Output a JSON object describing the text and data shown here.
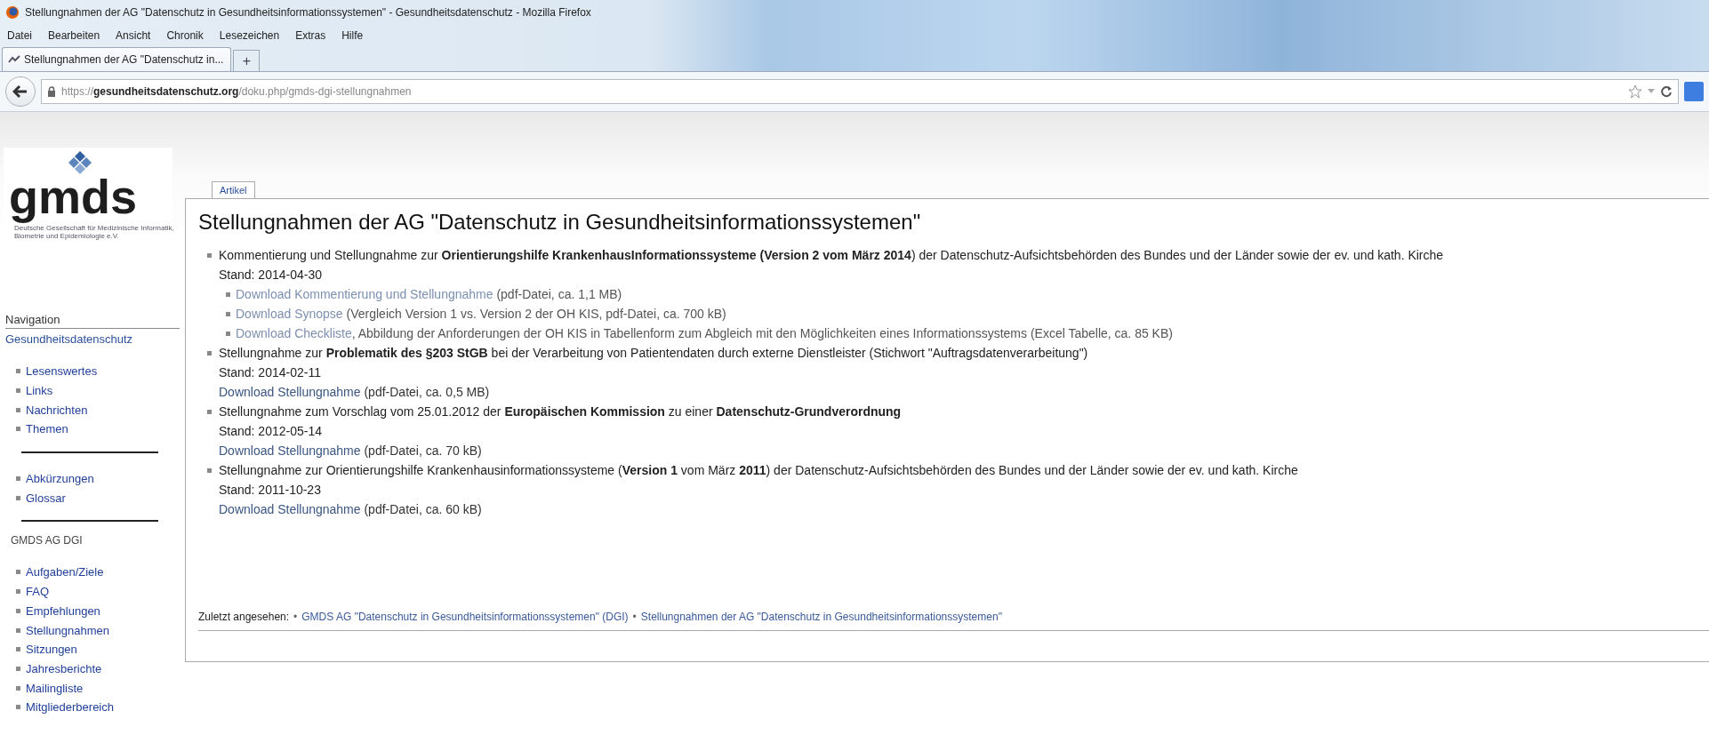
{
  "browser": {
    "window_title": "Stellungnahmen der AG \"Datenschutz in Gesundheitsinformationssystemen\" - Gesundheitsdatenschutz - Mozilla Firefox",
    "menu": [
      "Datei",
      "Bearbeiten",
      "Ansicht",
      "Chronik",
      "Lesezeichen",
      "Extras",
      "Hilfe"
    ],
    "tab_title": "Stellungnahmen der AG \"Datenschutz in...",
    "new_tab": "+",
    "url": "https://**gesundheitsdatenschutz.org**/doku.php/gmds-dgi-stellungnahmen"
  },
  "sidebar": {
    "logo": "gmds",
    "logo_tagline": "Deutsche Gesellschaft für Medizinische Informatik, Biometrie und Epidemiologie e.V.",
    "navigation_title": "Navigation",
    "home_link": "Gesundheitsdatenschutz",
    "groups": [
      {
        "items": [
          "Lesenswertes",
          "Links",
          "Nachrichten",
          "Themen"
        ]
      },
      {
        "items": [
          "Abkürzungen",
          "Glossar"
        ]
      },
      {
        "heading": "GMDS AG DGI",
        "items": [
          "Aufgaben/Ziele",
          "FAQ",
          "Empfehlungen",
          "Stellungnahmen",
          "Sitzungen",
          "Jahresberichte",
          "Mailingliste",
          "Mitgliederbereich"
        ]
      }
    ]
  },
  "content": {
    "tabs": [
      {
        "label": "Artikel",
        "selected": true
      }
    ],
    "title": "Stellungnahmen der AG \"Datenschutz in Gesundheitsinformationssystemen\"",
    "entries": [
      {
        "kind": "nested",
        "text": "Kommentierung und Stellungnahme zur **Orientierungshilfe KrankenhausInformationssysteme** **(Version 2 vom März 2014**) der Datenschutz-Aufsichtsbehörden des Bundes und der Länder sowie der ev. und kath. Kirche",
        "stand": "Stand: 2014-04-30",
        "downloads": [
          {
            "link": "Download Kommentierung und Stellungnahme",
            "note": " (pdf-Datei, ca. 1,1 MB)"
          },
          {
            "link": "Download Synopse",
            "note": " (Vergleich Version 1 vs. Version 2 der OH KIS, pdf-Datei, ca. 700 kB)"
          },
          {
            "link": "Download Checkliste",
            "note": ", Abbildung der Anforderungen der OH KIS in Tabellenform zum Abgleich mit den Möglichkeiten eines Informationssystems (Excel Tabelle, ca. 85 KB)"
          }
        ]
      },
      {
        "kind": "plain",
        "text": "Stellungnahme zur **Problematik des §203 StGB** bei der Verarbeitung von Patientendaten durch externe Dienstleister (Stichwort \"Auftragsdatenverarbeitung\")",
        "stand": "Stand: 2014-02-11",
        "downloads": [
          {
            "link": "Download Stellungnahme",
            "note": " (pdf-Datei, ca. 0,5 MB)"
          }
        ]
      },
      {
        "kind": "plain",
        "text": "Stellungnahme zum Vorschlag vom 25.01.2012 der **Europäischen Kommission** zu einer **Datenschutz-Grundverordnung**",
        "stand": "Stand: 2012-05-14",
        "downloads": [
          {
            "link": "Download Stellungnahme",
            "note": " (pdf-Datei, ca. 70 kB)"
          }
        ]
      },
      {
        "kind": "plain",
        "text": "Stellungnahme zur Orientierungshilfe Krankenhausinformationssysteme (**Version 1** vom März **2011**) der Datenschutz-Aufsichtsbehörden des Bundes und der Länder sowie der ev. und kath. Kirche",
        "stand": "Stand: 2011-10-23",
        "downloads": [
          {
            "link": "Download Stellungnahme",
            "note": " (pdf-Datei, ca. 60 kB)"
          }
        ]
      }
    ],
    "breadcrumbs": {
      "label": "Zuletzt angesehen:",
      "separator": "•",
      "links": [
        "GMDS AG \"Datenschutz in Gesundheitsinformationssystemen\" (DGI)",
        "Stellungnahmen der AG \"Datenschutz in Gesundheitsinformationssystemen\""
      ]
    }
  }
}
